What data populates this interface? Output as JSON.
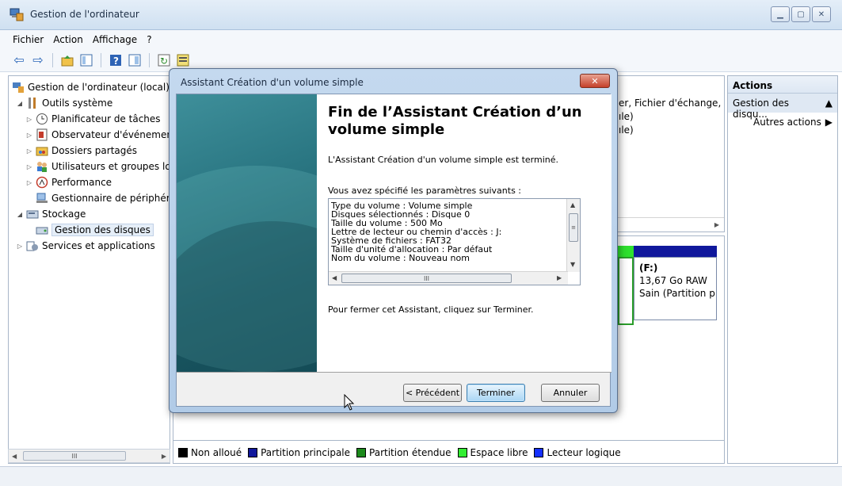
{
  "window": {
    "title": "Gestion de l'ordinateur",
    "controls": [
      "minimize",
      "maximize",
      "close"
    ]
  },
  "menu": [
    "Fichier",
    "Action",
    "Affichage",
    "?"
  ],
  "tree": {
    "items": [
      {
        "label": "Gestion de l'ordinateur (local)",
        "level": 0,
        "icon": "computer-management-icon"
      },
      {
        "label": "Outils système",
        "level": 1,
        "icon": "tools-icon",
        "expanded": true
      },
      {
        "label": "Planificateur de tâches",
        "level": 2,
        "icon": "clock-icon"
      },
      {
        "label": "Observateur d'événements",
        "level": 2,
        "icon": "event-viewer-icon"
      },
      {
        "label": "Dossiers partagés",
        "level": 2,
        "icon": "shared-folder-icon"
      },
      {
        "label": "Utilisateurs et groupes locaux",
        "level": 2,
        "icon": "users-icon"
      },
      {
        "label": "Performance",
        "level": 2,
        "icon": "performance-icon"
      },
      {
        "label": "Gestionnaire de périphériques",
        "level": 2,
        "icon": "device-manager-icon"
      },
      {
        "label": "Stockage",
        "level": 1,
        "icon": "storage-icon",
        "expanded": true
      },
      {
        "label": "Gestion des disques",
        "level": 2,
        "icon": "disk-icon",
        "selected": true
      },
      {
        "label": "Services et applications",
        "level": 1,
        "icon": "services-icon"
      }
    ]
  },
  "center": {
    "top_text": [
      "er, Fichier d'échange,",
      "ıle)",
      "ıle)"
    ],
    "disk_f": {
      "name": "(F:)",
      "size": "13,67 Go RAW",
      "status": "Sain (Partition p"
    },
    "legend": [
      {
        "label": "Non alloué",
        "color": "#000000"
      },
      {
        "label": "Partition principale",
        "color": "#10189c"
      },
      {
        "label": "Partition étendue",
        "color": "#1c8a1c"
      },
      {
        "label": "Espace libre",
        "color": "#33ee33"
      },
      {
        "label": "Lecteur logique",
        "color": "#1530ff"
      }
    ]
  },
  "actions": {
    "header": "Actions",
    "section": "Gestion des disqu...",
    "item": "Autres actions"
  },
  "dialog": {
    "title": "Assistant Création d'un volume simple",
    "heading": "Fin de l’Assistant Création d’un volume simple",
    "completed_text": "L'Assistant Création d'un volume simple est terminé.",
    "params_label": "Vous avez spécifié les paramètres suivants :",
    "params": [
      "Type du volume : Volume simple",
      "Disques sélectionnés : Disque 0",
      "Taille du volume : 500 Mo",
      "Lettre de lecteur ou chemin d'accès : J:",
      "Système de fichiers : FAT32",
      "Taille d'unité d'allocation : Par défaut",
      "Nom du volume : Nouveau nom"
    ],
    "close_text": "Pour fermer cet Assistant, cliquez sur Terminer.",
    "buttons": {
      "back": "< Précédent",
      "finish": "Terminer",
      "cancel": "Annuler"
    }
  }
}
